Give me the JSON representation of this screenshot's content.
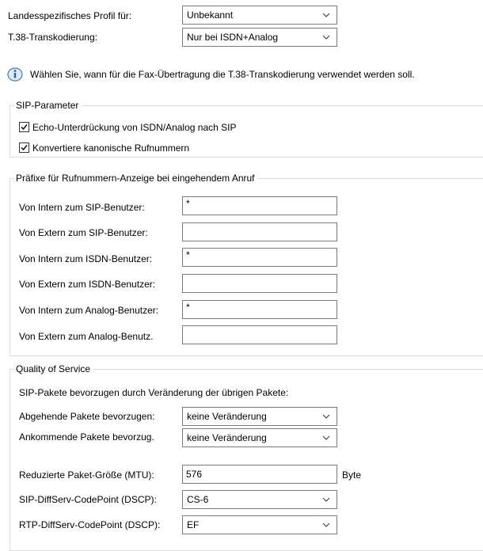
{
  "top": {
    "country_profile": {
      "label": "Landesspezifisches Profil für:",
      "value": "Unbekannt"
    },
    "t38": {
      "label": "T.38-Transkodierung:",
      "value": "Nur bei ISDN+Analog"
    },
    "info_text": "Wählen Sie, wann für die Fax-Übertragung die T.38-Transkodierung verwendet werden soll."
  },
  "sip_params": {
    "legend": "SIP-Parameter",
    "checkboxes": [
      {
        "label": "Echo-Unterdrückung von ISDN/Analog nach SIP",
        "checked": true
      },
      {
        "label": "Konvertiere kanonische Rufnummern",
        "checked": true
      }
    ]
  },
  "prefixes": {
    "legend": "Präfixe für Rufnummern-Anzeige bei eingehendem Anruf",
    "rows": [
      {
        "label": "Von Intern zum SIP-Benutzer:",
        "value": "*"
      },
      {
        "label": "Von Extern zum SIP-Benutzer:",
        "value": ""
      },
      {
        "label": "Von Intern zum ISDN-Benutzer:",
        "value": "*"
      },
      {
        "label": "Von Extern zum ISDN-Benutzer:",
        "value": ""
      },
      {
        "label": "Von Intern zum Analog-Benutzer:",
        "value": "*"
      },
      {
        "label": "Von Extern zum Analog-Benutz.",
        "value": ""
      }
    ]
  },
  "qos": {
    "legend": "Quality of Service",
    "intro": "SIP-Pakete bevorzugen durch Veränderung der übrigen Pakete:",
    "outgoing": {
      "label": "Abgehende Pakete bevorzugen:",
      "value": "keine Veränderung"
    },
    "incoming": {
      "label": "Ankommende Pakete bevorzug.",
      "value": "keine Veränderung"
    },
    "mtu": {
      "label": "Reduzierte Paket-Größe (MTU):",
      "value": "576",
      "unit": "Byte"
    },
    "sip_dscp": {
      "label": "SIP-DiffServ-CodePoint (DSCP):",
      "value": "CS-6"
    },
    "rtp_dscp": {
      "label": "RTP-DiffServ-CodePoint (DSCP):",
      "value": "EF"
    }
  },
  "colors": {
    "border": "#7a7a7a",
    "group_border": "#dcdcdc",
    "info_icon": "#3f7fbf"
  },
  "icons": {
    "info": "info-icon",
    "dropdown": "chevron-down-icon",
    "check": "checkmark-icon"
  }
}
